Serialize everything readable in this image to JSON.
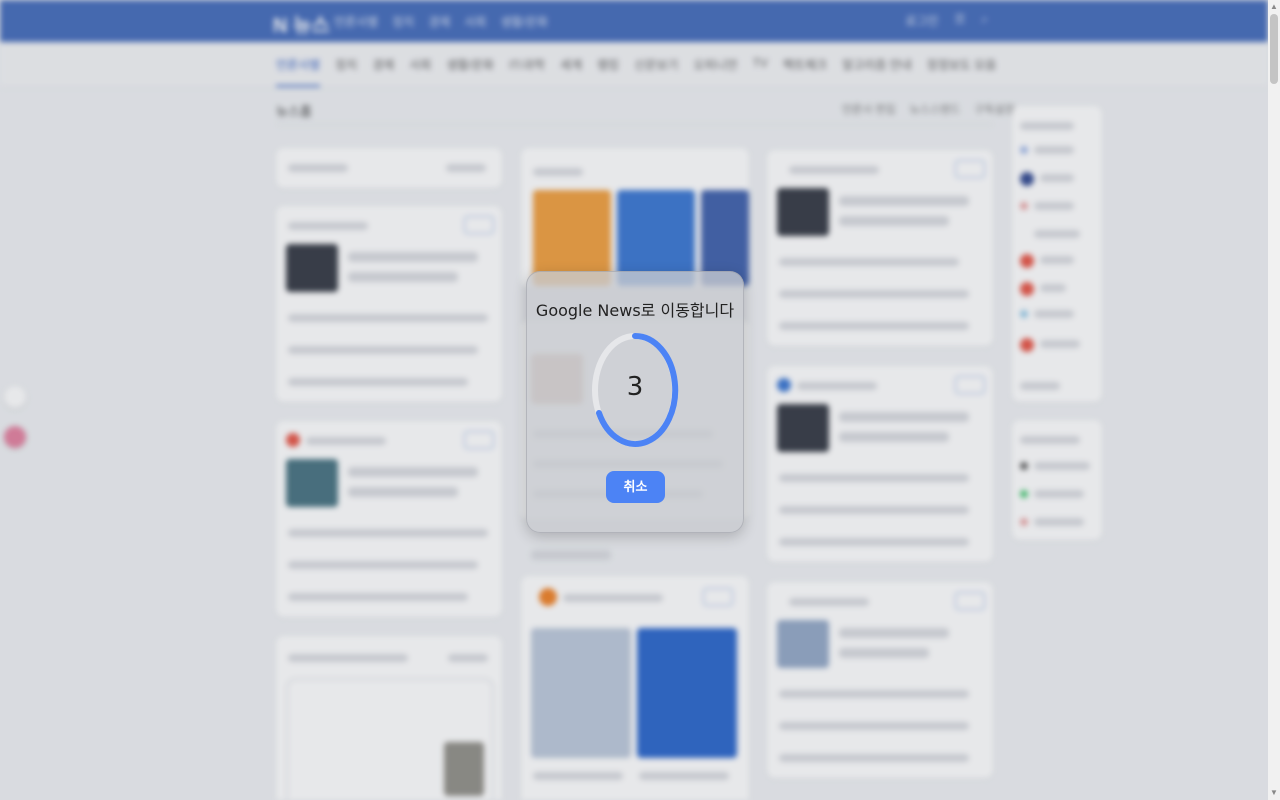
{
  "header": {
    "logo": "N 뉴스",
    "nav": [
      "언론사별",
      "정치",
      "경제",
      "사회",
      "생활/문화"
    ],
    "right": [
      "로그인",
      "메뉴"
    ]
  },
  "tabs": [
    "언론사별",
    "정치",
    "경제",
    "사회",
    "생활/문화",
    "IT/과학",
    "세계",
    "랭킹",
    "신문보기",
    "오피니언",
    "TV",
    "팩트체크",
    "알고리즘 안내",
    "정정보도 모음"
  ],
  "main": {
    "section": "뉴스홈",
    "section_right": [
      "언론사 편집",
      "뉴스스탠드",
      "구독설정"
    ]
  },
  "modal": {
    "title": "Google News로 이동합니다",
    "countdown": "3",
    "cancel_label": "취소",
    "accent": "#4c83f5"
  }
}
